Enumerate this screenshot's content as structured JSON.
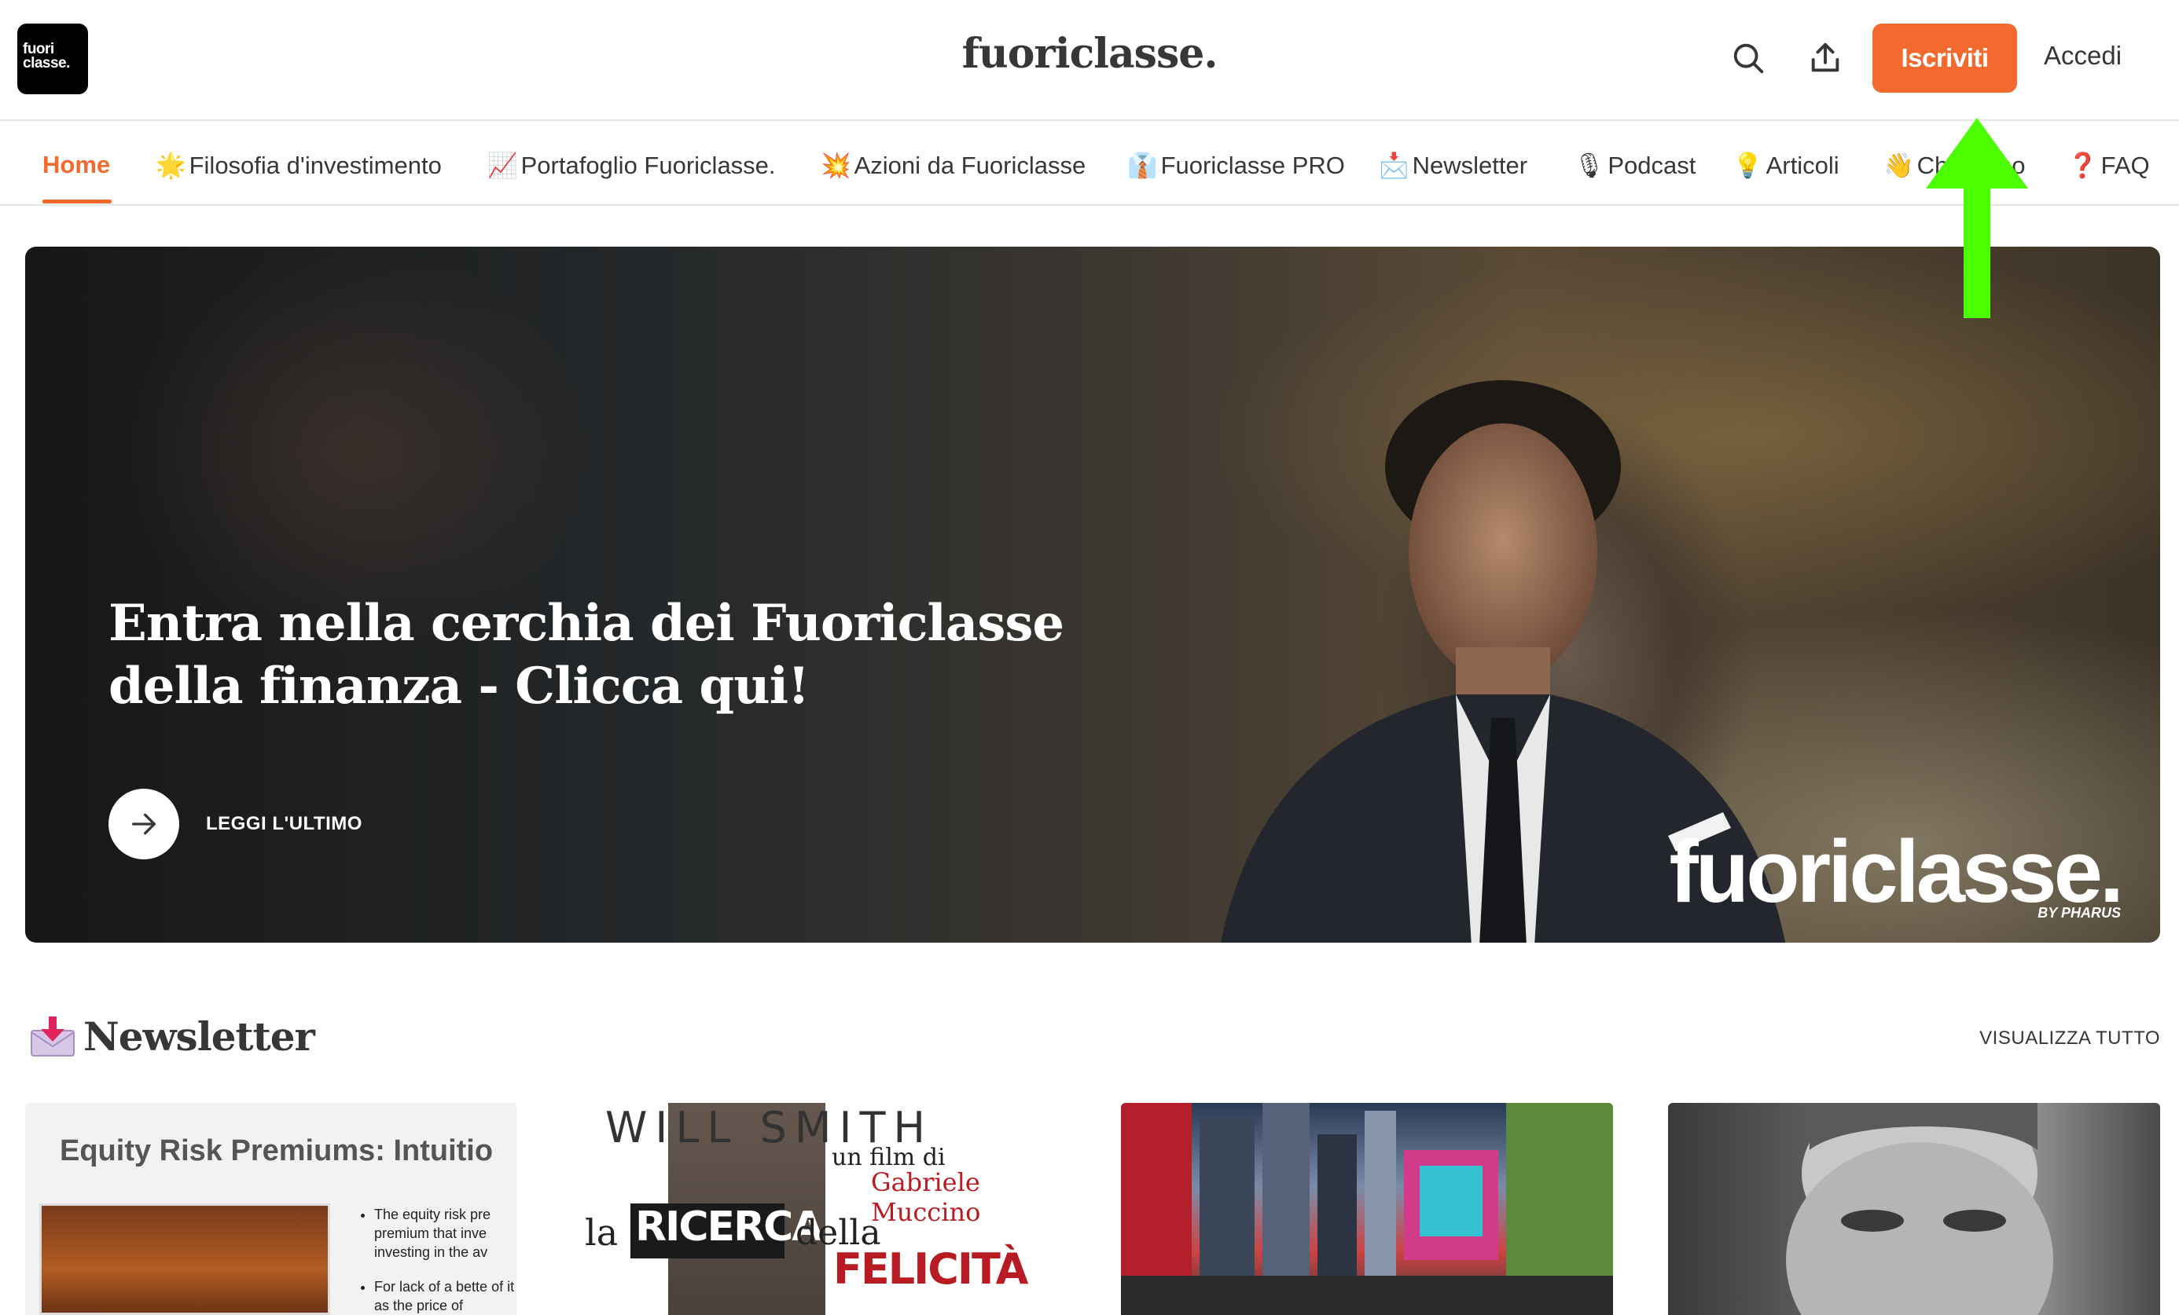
{
  "header": {
    "logo_line1": "fuori",
    "logo_line2": "classe.",
    "site_title": "fuoriclasse.",
    "subscribe_label": "Iscriviti",
    "login_label": "Accedi"
  },
  "nav": {
    "items": [
      {
        "label": "Home",
        "emoji": ""
      },
      {
        "label": "Filosofia d'investimento",
        "emoji": "🌟"
      },
      {
        "label": "Portafoglio Fuoriclasse.",
        "emoji": "📈"
      },
      {
        "label": "Azioni da Fuoriclasse",
        "emoji": "💥"
      },
      {
        "label": "Fuoriclasse PRO",
        "emoji": "👔"
      },
      {
        "label": "Newsletter",
        "emoji": "📩"
      },
      {
        "label": "Podcast",
        "emoji": "🎙"
      },
      {
        "label": "Articoli",
        "emoji": "💡"
      },
      {
        "label": "Chi siamo",
        "emoji": "👋"
      },
      {
        "label": "FAQ",
        "emoji": "❓"
      }
    ],
    "active_index": 0
  },
  "hero": {
    "title": "Entra nella cerchia dei Fuoriclasse della finanza - Clicca qui!",
    "cta_label": "LEGGI L'ULTIMO",
    "brand_overlay": "fuoriclasse.",
    "brand_sub": "BY PHARUS"
  },
  "newsletter": {
    "title": "Newsletter",
    "view_all": "VISUALIZZA TUTTO",
    "cards": [
      {
        "title": "Equity Risk Premiums: Intuitio",
        "bullets": [
          "The equity risk pre premium that inve investing in the av",
          "For lack of a bette of it as the price of"
        ]
      },
      {
        "top": "WILL SMITH",
        "sub1": "un film di",
        "sub2": "Gabriele Muccino",
        "la": "la",
        "ricerca": "RICERCA",
        "della": "della",
        "felicita": "FELICITÀ"
      },
      {},
      {}
    ]
  },
  "colors": {
    "accent": "#f26a2e",
    "text": "#363737",
    "annotation": "#4cff00"
  }
}
